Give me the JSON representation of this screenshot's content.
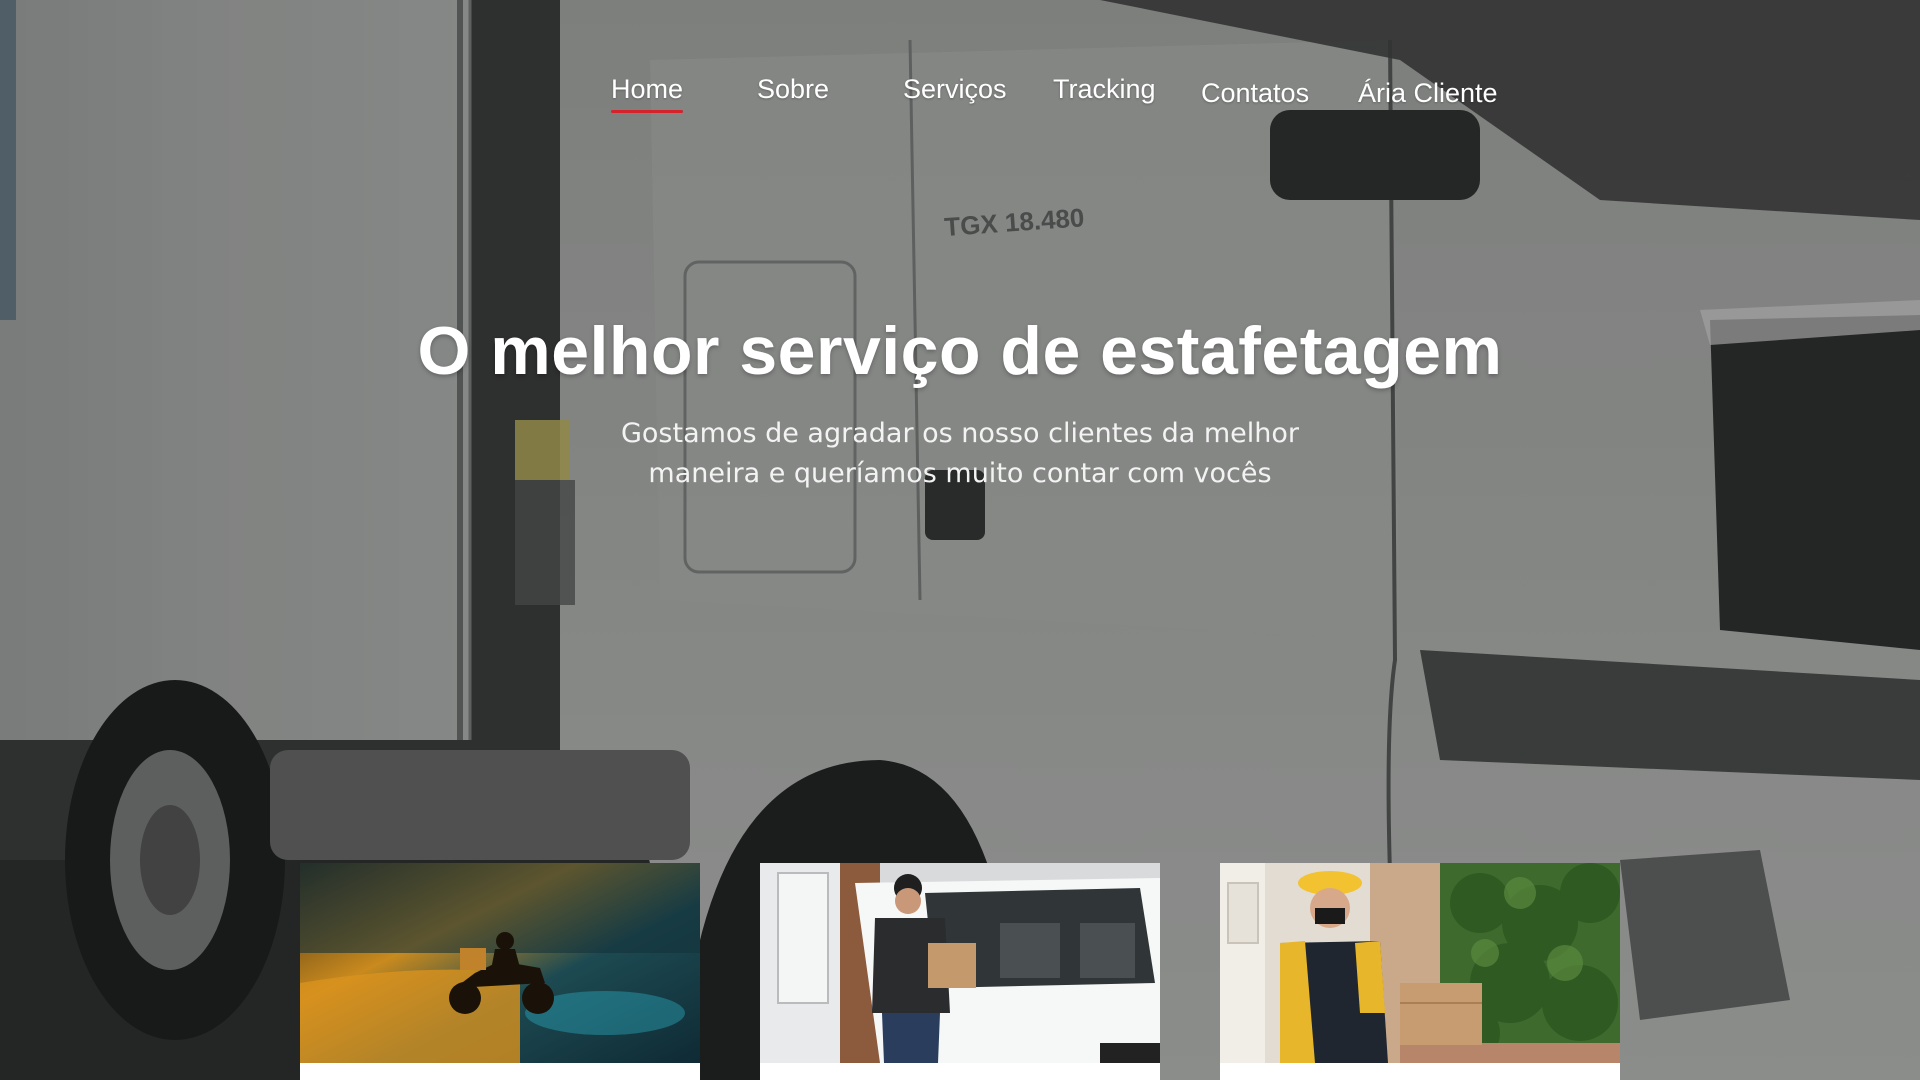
{
  "nav": {
    "items": [
      {
        "label": "Home",
        "active": true
      },
      {
        "label": "Sobre",
        "active": false
      },
      {
        "label": "Serviços",
        "active": false
      },
      {
        "label": "Tracking",
        "active": false
      },
      {
        "label": "Contatos",
        "active": false
      },
      {
        "label": "Ária Cliente",
        "active": false
      }
    ],
    "active_underline_color": "#d4232a"
  },
  "hero": {
    "title": "O melhor serviço de estafetagem",
    "subtitle": "Gostamos de agradar os nosso clientes da melhor maneira e queríamos muito contar com vocês",
    "background": "photo of a white truck cab, darkened overlay",
    "truck_badge_text": "TGX 18.480"
  },
  "cards": [
    {
      "image": "motorcycle courier riding at night"
    },
    {
      "image": "courier loading parcel into white van"
    },
    {
      "image": "courier in yellow cap on phone delivering a box"
    }
  ],
  "colors": {
    "text": "#ffffff",
    "accent": "#d4232a"
  }
}
